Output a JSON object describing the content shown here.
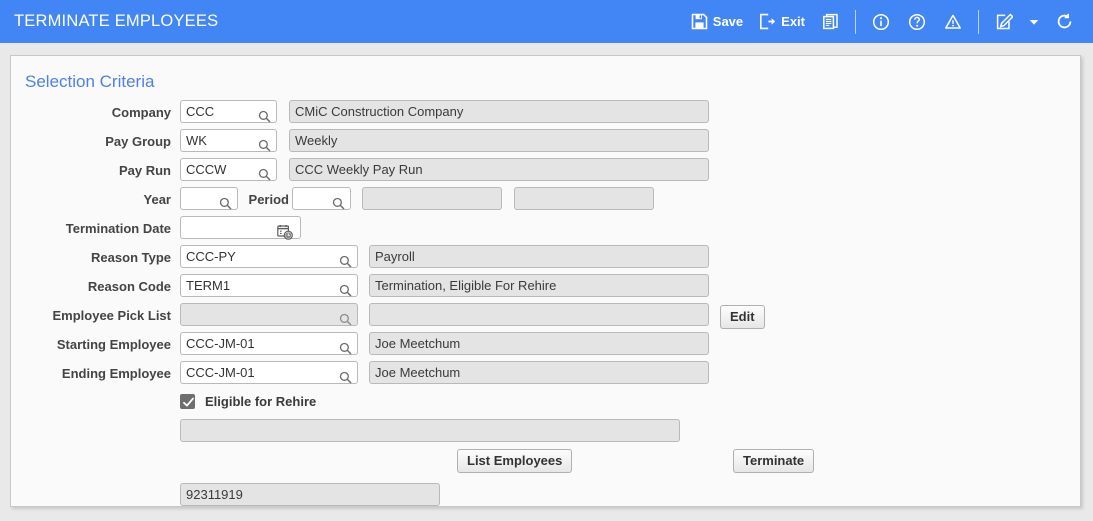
{
  "header": {
    "title": "TERMINATE EMPLOYEES",
    "accent_color": "#4286f5",
    "buttons": [
      {
        "name": "save",
        "label": "Save",
        "icon": "save-icon"
      },
      {
        "name": "exit",
        "label": "Exit",
        "icon": "exit-icon"
      },
      {
        "name": "copy",
        "label": "",
        "icon": "copy-document-icon"
      },
      {
        "name": "info",
        "label": "",
        "icon": "info-icon"
      },
      {
        "name": "help",
        "label": "",
        "icon": "help-icon"
      },
      {
        "name": "warning",
        "label": "",
        "icon": "warning-icon"
      },
      {
        "name": "notes",
        "label": "",
        "icon": "edit-note-icon"
      },
      {
        "name": "dropdown",
        "label": "",
        "icon": "chevron-down-icon"
      },
      {
        "name": "refresh",
        "label": "",
        "icon": "refresh-icon"
      }
    ]
  },
  "panel": {
    "title": "Selection Criteria",
    "title_color": "#4e80e8"
  },
  "fields": {
    "company": {
      "label": "Company",
      "code": "CCC",
      "description": "CMiC Construction Company"
    },
    "pay_group": {
      "label": "Pay Group",
      "code": "WK",
      "description": "Weekly"
    },
    "pay_run": {
      "label": "Pay Run",
      "code": "CCCW",
      "description": "CCC Weekly Pay Run"
    },
    "year": {
      "label": "Year",
      "value": ""
    },
    "period": {
      "label": "Period",
      "value": "",
      "description_1": "",
      "description_2": ""
    },
    "termination_date": {
      "label": "Termination Date",
      "value": ""
    },
    "reason_type": {
      "label": "Reason Type",
      "code": "CCC-PY",
      "description": "Payroll"
    },
    "reason_code": {
      "label": "Reason Code",
      "code": "TERM1",
      "description": "Termination, Eligible For Rehire"
    },
    "employee_pick_list": {
      "label": "Employee Pick List",
      "code": "",
      "description": "",
      "edit_label": "Edit"
    },
    "starting_employee": {
      "label": "Starting Employee",
      "code": "CCC-JM-01",
      "description": "Joe Meetchum"
    },
    "ending_employee": {
      "label": "Ending Employee",
      "code": "CCC-JM-01",
      "description": "Joe Meetchum"
    },
    "eligible_for_rehire": {
      "label": "Eligible for Rehire",
      "checked": true
    },
    "message_bar": {
      "value": ""
    },
    "status_value": {
      "value": "92311919"
    }
  },
  "actions": {
    "list_employees": "List Employees",
    "terminate": "Terminate"
  }
}
